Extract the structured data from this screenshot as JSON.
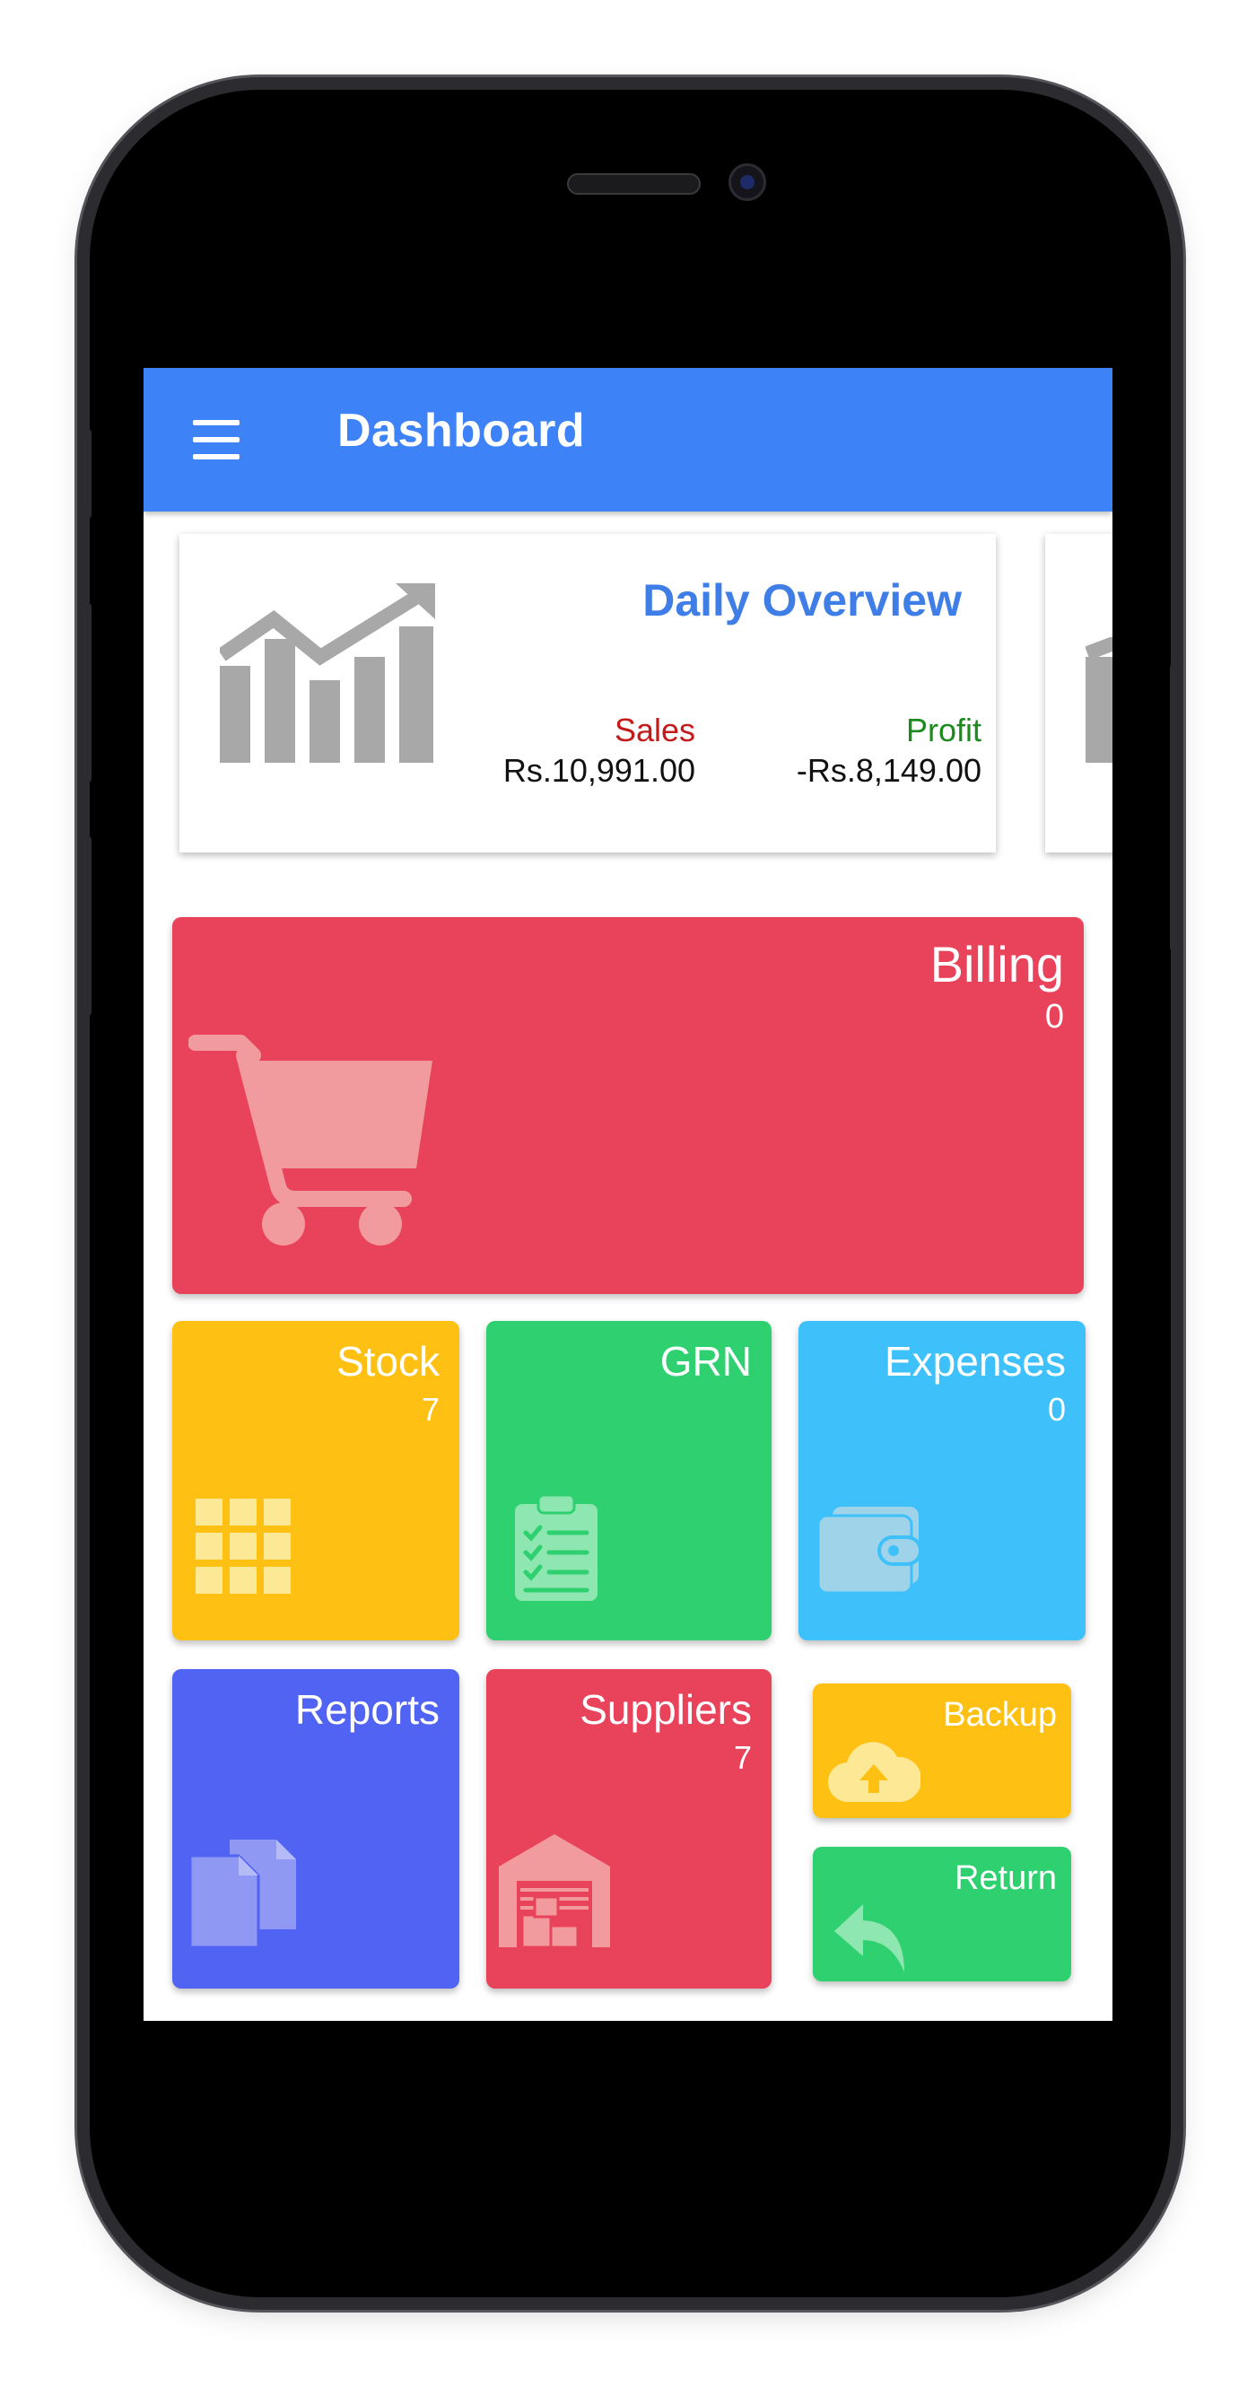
{
  "appbar": {
    "title": "Dashboard",
    "menu_icon": "hamburger-menu-icon",
    "color": "#3e82f7"
  },
  "overview": {
    "title": "Daily Overview",
    "chart_icon": "trending-chart-icon",
    "sales_label": "Sales",
    "sales_value": "Rs.10,991.00",
    "profit_label": "Profit",
    "profit_value": "-Rs.8,149.00",
    "sales_color": "#c41a1a",
    "profit_color": "#1c8a1c"
  },
  "tiles": {
    "billing": {
      "label": "Billing",
      "count": "0",
      "icon": "shopping-cart-icon",
      "color": "#e8435a"
    },
    "stock": {
      "label": "Stock",
      "count": "7",
      "icon": "grid-icon",
      "color": "#fdc013"
    },
    "grn": {
      "label": "GRN",
      "icon": "clipboard-checklist-icon",
      "color": "#2fd070"
    },
    "expenses": {
      "label": "Expenses",
      "count": "0",
      "icon": "wallet-icon",
      "color": "#3ec1fb"
    },
    "reports": {
      "label": "Reports",
      "icon": "documents-icon",
      "color": "#5063f2"
    },
    "suppliers": {
      "label": "Suppliers",
      "count": "7",
      "icon": "warehouse-icon",
      "color": "#e8435a"
    },
    "backup": {
      "label": "Backup",
      "icon": "cloud-upload-icon",
      "color": "#fdc013"
    },
    "return": {
      "label": "Return",
      "icon": "reply-arrow-icon",
      "color": "#2fd070"
    }
  }
}
